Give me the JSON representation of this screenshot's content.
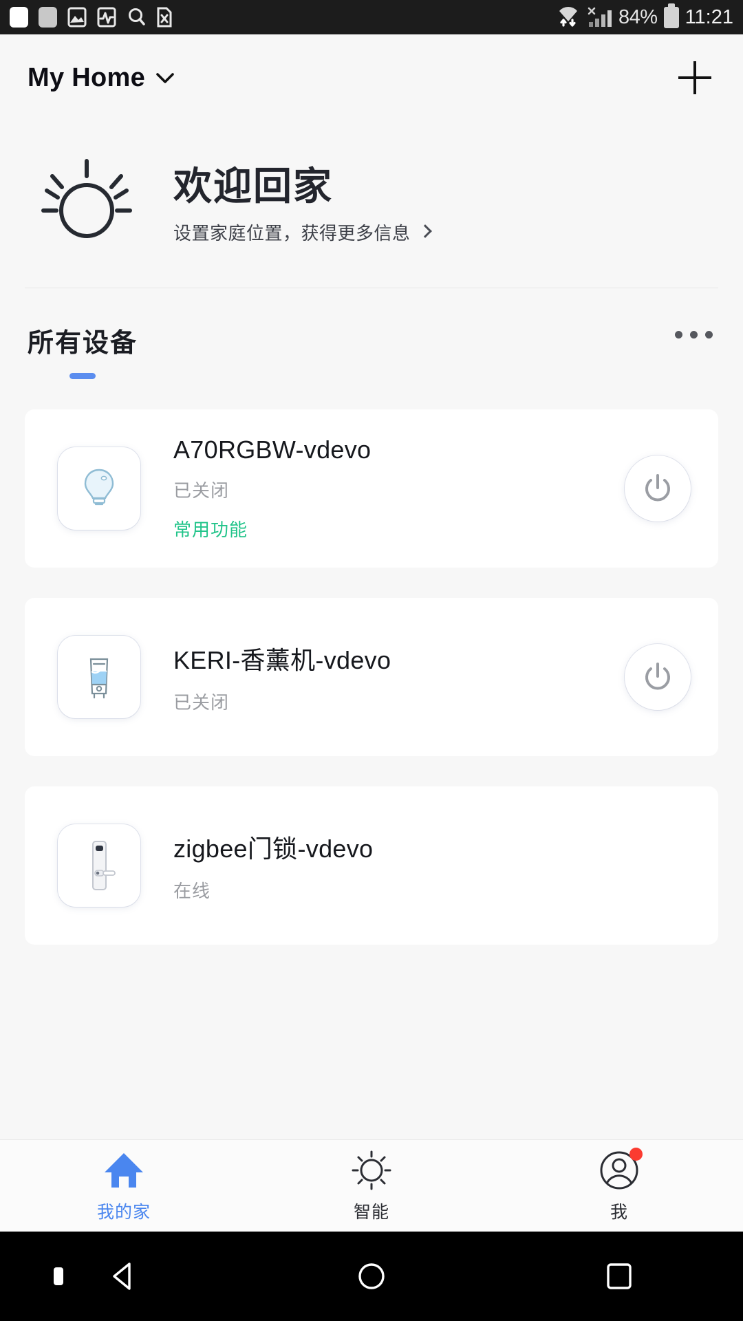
{
  "statusbar": {
    "icons": [
      "white-rounded-square-icon",
      "grey-rounded-square-icon",
      "image-icon",
      "pulse-icon",
      "search-icon",
      "file-x-icon"
    ],
    "wifi_icon": "wifi-transfer-icon",
    "signal_icon": "cellular-signal-no-sim-icon",
    "battery_percent": "84%",
    "battery_icon": "battery-full-icon",
    "time": "11:21"
  },
  "appbar": {
    "home_name": "My Home",
    "dropdown_icon": "chevron-down-icon",
    "add_icon": "plus-icon"
  },
  "welcome": {
    "weather_icon": "sun-icon",
    "title": "欢迎回家",
    "subtitle": "设置家庭位置，获得更多信息",
    "arrow_icon": "chevron-right-icon"
  },
  "tabs": {
    "items": [
      {
        "label": "所有设备",
        "active": true
      }
    ],
    "more_icon": "more-horizontal-icon"
  },
  "devices": [
    {
      "name": "A70RGBW-vdevo",
      "status": "已关闭",
      "extra": "常用功能",
      "icon": "light-bulb-icon",
      "has_power": true,
      "power_icon": "power-icon"
    },
    {
      "name": "KERI-香薰机-vdevo",
      "status": "已关闭",
      "extra": "",
      "icon": "aroma-diffuser-icon",
      "has_power": true,
      "power_icon": "power-icon"
    },
    {
      "name": "zigbee门锁-vdevo",
      "status": "在线",
      "extra": "",
      "icon": "door-lock-icon",
      "has_power": false,
      "power_icon": ""
    }
  ],
  "bottomnav": [
    {
      "label": "我的家",
      "icon": "home-icon",
      "active": true,
      "badge": false
    },
    {
      "label": "智能",
      "icon": "sun-smart-icon",
      "active": false,
      "badge": false
    },
    {
      "label": "我",
      "icon": "person-icon",
      "active": false,
      "badge": true
    }
  ],
  "androidnav": {
    "back_icon": "triangle-back-icon",
    "home_icon": "circle-home-icon",
    "recents_icon": "square-recents-icon"
  },
  "colors": {
    "accent_blue": "#5b8def",
    "nav_blue": "#4a86ef",
    "green": "#22c48a",
    "badge_red": "#fb3b30",
    "background": "#f7f7f7",
    "card": "#ffffff"
  }
}
